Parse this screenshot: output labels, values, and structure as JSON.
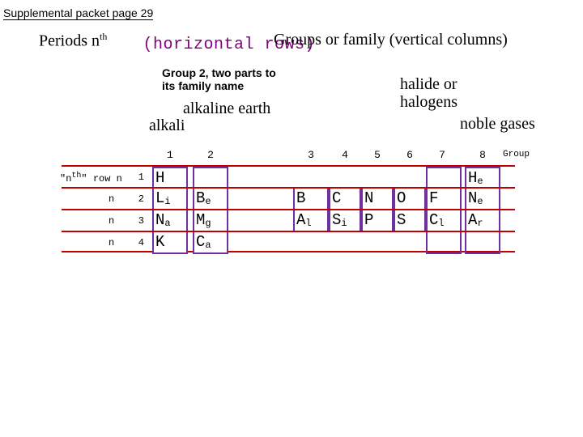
{
  "header": "Supplemental packet page 29",
  "top": {
    "periods_a": "Periods n",
    "periods_sup": "th",
    "horizontal": "　(horizontal rows)",
    "groups": "Groups or family (vertical columns)"
  },
  "labels": {
    "group2_note_l1": "Group 2, two parts to",
    "group2_note_l2": "its family name",
    "alkaline_earth": "alkaline earth",
    "alkali": "alkali",
    "halide_l1": "halide or",
    "halide_l2": "halogens",
    "noble_gases": "noble gases"
  },
  "columns": {
    "nums": {
      "c1": "1",
      "c2": "2",
      "c3": "3",
      "c4": "4",
      "c5": "5",
      "c6": "6",
      "c7": "7",
      "c8": "8"
    },
    "group_word": "Group"
  },
  "rows": {
    "r1": {
      "label_a": "\"n<sup>th</sup>\" row  n",
      "n": "1"
    },
    "r2": {
      "label_a": "n",
      "n": "2"
    },
    "r3": {
      "label_a": "n",
      "n": "3"
    },
    "r4": {
      "label_a": "n",
      "n": "4"
    }
  },
  "elements": {
    "H": "H",
    "He_a": "H",
    "He_b": "e",
    "Li_a": "L",
    "Li_b": "i",
    "Be_a": "B",
    "Be_b": "e",
    "B": "B",
    "C": "C",
    "N": "N",
    "O": "O",
    "F": "F",
    "Ne_a": "N",
    "Ne_b": "e",
    "Na_a": "N",
    "Na_b": "a",
    "Mg_a": "M",
    "Mg_b": "g",
    "Al_a": "A",
    "Al_b": "l",
    "Si_a": "S",
    "Si_b": "i",
    "P": "P",
    "S": "S",
    "Cl_a": "C",
    "Cl_b": "l",
    "Ar_a": "A",
    "Ar_b": "r",
    "K": "K",
    "Ca_a": "C",
    "Ca_b": "a"
  }
}
